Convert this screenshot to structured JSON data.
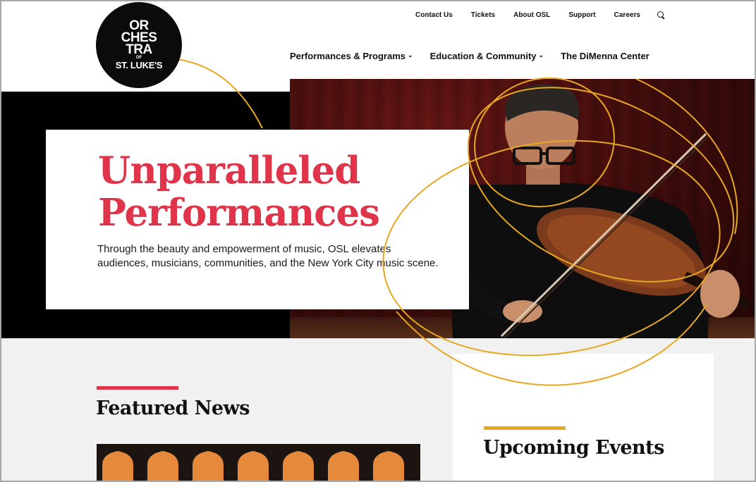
{
  "logo": {
    "line1": "OR",
    "line2": "CHES",
    "line3": "TRA",
    "line4": "OF",
    "line5": "ST. LUKE'S"
  },
  "util_nav": {
    "items": [
      "Contact Us",
      "Tickets",
      "About OSL",
      "Support",
      "Careers"
    ],
    "search_icon": "search-icon"
  },
  "main_nav": {
    "items": [
      {
        "label": "Performances & Programs",
        "has_dropdown": true
      },
      {
        "label": "Education & Community",
        "has_dropdown": true
      },
      {
        "label": "The DiMenna Center",
        "has_dropdown": false
      }
    ],
    "chevron": "⌄"
  },
  "hero": {
    "title_line1": "Unparalleled",
    "title_line2": "Performances",
    "text": "Through the beauty and empowerment of music, OSL elevates audiences, musicians, communities, and the New York City music scene."
  },
  "featured_news": {
    "title": "Featured News"
  },
  "upcoming_events": {
    "title": "Upcoming Events"
  },
  "colors": {
    "accent_red": "#e0344a",
    "accent_gold": "#e8a721",
    "black": "#000000"
  }
}
